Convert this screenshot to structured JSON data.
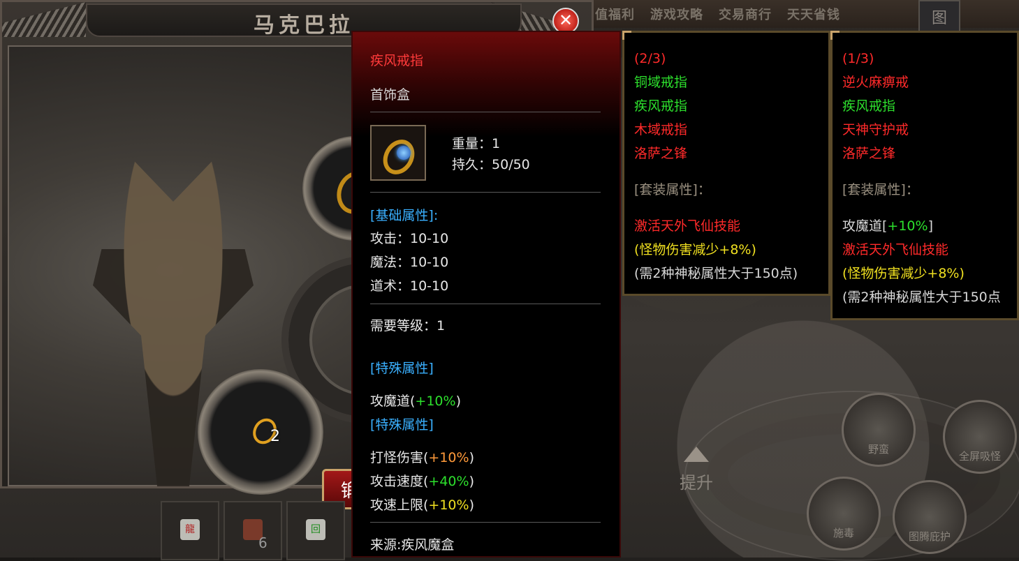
{
  "window": {
    "title": "马克巴拉",
    "close_symbol": "✕"
  },
  "topnav": {
    "items": [
      "值福利",
      "游戏攻略",
      "交易商行",
      "天天省钱"
    ],
    "map_label": "图"
  },
  "slots": {
    "bottom_count": "2"
  },
  "action_button_label": "锻",
  "skillbar": [
    {
      "icon": "dragon-scroll-icon",
      "glyph": "龍",
      "count": ""
    },
    {
      "icon": "potion-icon",
      "glyph": "",
      "count": "6"
    },
    {
      "icon": "return-scroll-icon",
      "glyph": "回",
      "count": ""
    }
  ],
  "tooltip": {
    "name": "疾风戒指",
    "type": "首饰盒",
    "weight_label": "重量：",
    "weight_value": "1",
    "durability_label": "持久：",
    "durability_value": "50/50",
    "base_attr_header": "[基础属性]:",
    "attack": "攻击：10-10",
    "magic": "魔法：10-10",
    "taoism": "道术：10-10",
    "req_level": "需要等级：1",
    "special_header_1": "[特殊属性]",
    "special_1_name": "攻魔道(",
    "special_1_value": "+10%",
    "special_1_close": ")",
    "special_header_2": "[特殊属性]",
    "special_2": [
      {
        "name": "打怪伤害(",
        "value": "+10%",
        "close": ")",
        "color": "orange"
      },
      {
        "name": "攻击速度(",
        "value": "+40%",
        "close": ")",
        "color": "green"
      },
      {
        "name": "攻速上限(",
        "value": "+10%",
        "close": ")",
        "color": "yellow"
      }
    ],
    "source": "来源:疾风魔盒"
  },
  "set1": {
    "count": "(2/3)",
    "items": [
      {
        "name": "铜域戒指",
        "color": "green"
      },
      {
        "name": "疾风戒指",
        "color": "green"
      },
      {
        "name": "木域戒指",
        "color": "red"
      },
      {
        "name": "洛萨之锋",
        "color": "red"
      }
    ],
    "attr_header": "[套装属性]：",
    "lines": [
      {
        "text": "激活天外飞仙技能",
        "color": "red"
      },
      {
        "text": "(怪物伤害减少+8%)",
        "color": "yellow"
      },
      {
        "text": "(需2种神秘属性大于150点)",
        "color": "gray"
      }
    ]
  },
  "set2": {
    "count": "(1/3)",
    "items": [
      {
        "name": "逆火麻痹戒",
        "color": "red"
      },
      {
        "name": "疾风戒指",
        "color": "green"
      },
      {
        "name": "天神守护戒",
        "color": "red"
      },
      {
        "name": "洛萨之锋",
        "color": "red"
      }
    ],
    "attr_header": "[套装属性]：",
    "lead_label": "攻魔道[",
    "lead_value": "+10%",
    "lead_close": "]",
    "lines": [
      {
        "text": "激活天外飞仙技能",
        "color": "red"
      },
      {
        "text": "(怪物伤害减少+8%)",
        "color": "yellow"
      },
      {
        "text": "(需2种神秘属性大于150点",
        "color": "gray"
      }
    ]
  },
  "right_buttons": {
    "upgrade": "提升",
    "wild": "野蛮",
    "fullscreen_absorb": "全屏吸怪",
    "poison": "施毒",
    "totem_protect": "图腾庇护"
  }
}
